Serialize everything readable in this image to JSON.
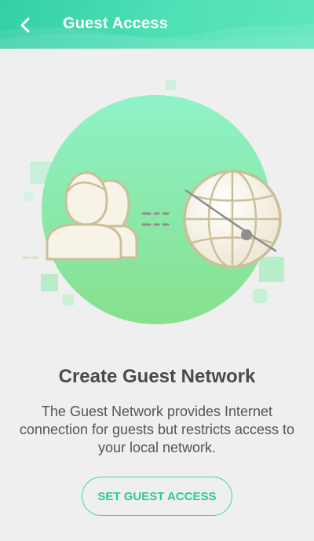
{
  "header": {
    "title": "Guest Access",
    "back_icon": "chevron-left-icon"
  },
  "illustration": {
    "guest_icon": "guests-icon",
    "globe_icon": "globe-icon",
    "colors": {
      "circle_top": "#8ff0c2",
      "circle_bottom": "#7fe08a",
      "outline": "#cbbf9a",
      "fill": "#f7f3e6"
    }
  },
  "content": {
    "headline": "Create Guest Network",
    "description": "The Guest Network provides Internet connection for guests but restricts access to your local network.",
    "button_label": "SET GUEST ACCESS"
  },
  "colors": {
    "accent": "#3fd3a9",
    "header_gradient_start": "#34cfa6",
    "header_gradient_end": "#5ee6bd"
  }
}
